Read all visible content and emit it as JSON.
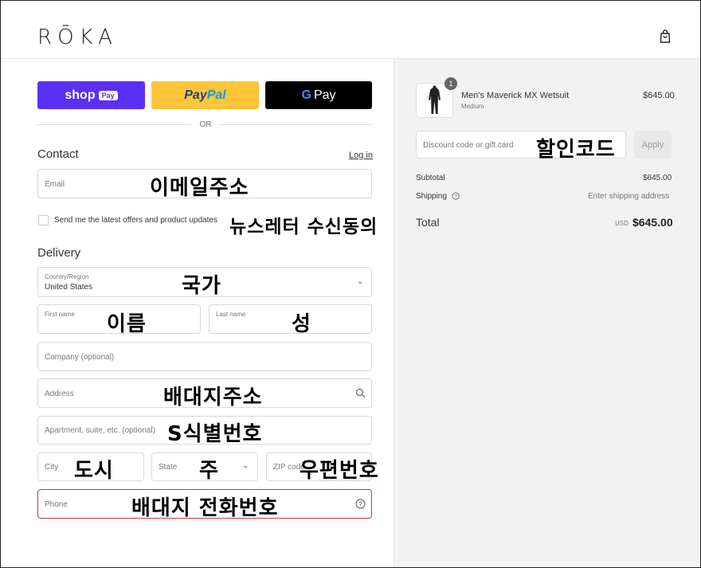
{
  "brand": {
    "logo": "RŌKA"
  },
  "express": {
    "shop_label": "shop",
    "shop_pill": "Pay",
    "paypal_a": "Pay",
    "paypal_b": "Pal",
    "gpay_g": "G",
    "gpay_label": "Pay",
    "or_label": "OR"
  },
  "contact": {
    "title": "Contact",
    "login_label": "Log in",
    "email_placeholder": "Email",
    "email_annotation": "이메일주소",
    "newsletter_label": "Send me the latest offers and product updates",
    "newsletter_annotation": "뉴스레터 수신동의"
  },
  "delivery": {
    "title": "Delivery",
    "country_label": "Country/Region",
    "country_value": "United States",
    "country_annotation": "국가",
    "first_name_placeholder": "First name",
    "first_name_annotation": "이름",
    "last_name_placeholder": "Last name",
    "last_name_annotation": "성",
    "company_placeholder": "Company (optional)",
    "address_placeholder": "Address",
    "address_annotation": "배대지주소",
    "apartment_placeholder": "Apartment, suite, etc. (optional)",
    "apartment_annotation": "S식별번호",
    "city_placeholder": "City",
    "city_annotation": "도시",
    "state_placeholder": "State",
    "state_annotation": "주",
    "zip_placeholder": "ZIP code",
    "zip_annotation": "우편번호",
    "phone_placeholder": "Phone",
    "phone_annotation": "배대지 전화번호"
  },
  "summary": {
    "item_qty": "1",
    "item_name": "Men's Maverick MX Wetsuit",
    "item_variant": "Medium",
    "item_price": "$645.00",
    "discount_placeholder": "Discount code or gift card",
    "discount_annotation": "할인코드",
    "apply_label": "Apply",
    "subtotal_label": "Subtotal",
    "subtotal_value": "$645.00",
    "shipping_label": "Shipping",
    "shipping_value": "Enter shipping address",
    "total_label": "Total",
    "currency": "USD",
    "total_value": "$645.00"
  },
  "colors": {
    "shop_pay": "#5a31f4",
    "paypal": "#ffc439",
    "gpay": "#000000",
    "phone_border": "#b94040",
    "summary_bg": "#f2f2f2"
  }
}
